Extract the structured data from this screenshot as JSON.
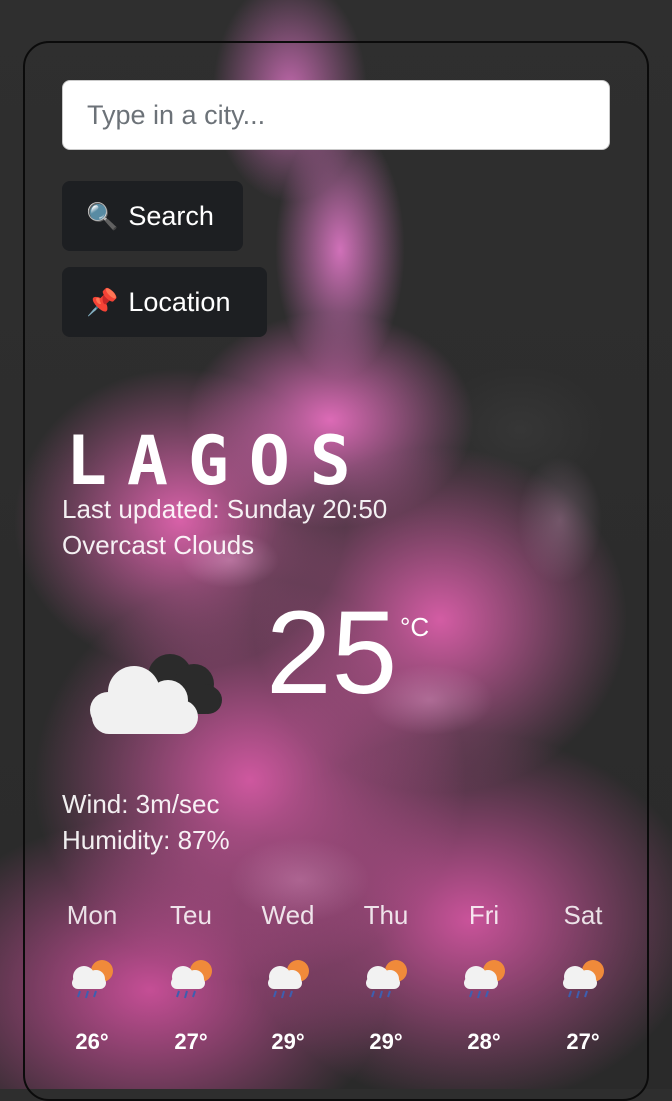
{
  "search": {
    "placeholder": "Type in a city..."
  },
  "buttons": {
    "search_label": "Search",
    "search_icon": "magnifier-icon",
    "location_label": "Location",
    "location_icon": "pushpin-icon"
  },
  "weather": {
    "city": "LAGOS",
    "last_updated": "Last updated: Sunday 20:50",
    "description": "Overcast Clouds",
    "temperature": "25",
    "unit": "°C",
    "wind": "Wind: 3m/sec",
    "humidity": "Humidity: 87%",
    "icon": "overcast-clouds-icon"
  },
  "forecast": [
    {
      "day": "Mon",
      "high": "26°",
      "icon": "rain-sun-icon"
    },
    {
      "day": "Teu",
      "high": "27°",
      "icon": "rain-sun-icon"
    },
    {
      "day": "Wed",
      "high": "29°",
      "icon": "rain-sun-icon"
    },
    {
      "day": "Thu",
      "high": "29°",
      "icon": "rain-sun-icon"
    },
    {
      "day": "Fri",
      "high": "28°",
      "icon": "rain-sun-icon"
    },
    {
      "day": "Sat",
      "high": "27°",
      "icon": "rain-sun-icon"
    }
  ],
  "colors": {
    "button_bg": "#1d1f22",
    "accent_pink": "#e06fbf"
  }
}
